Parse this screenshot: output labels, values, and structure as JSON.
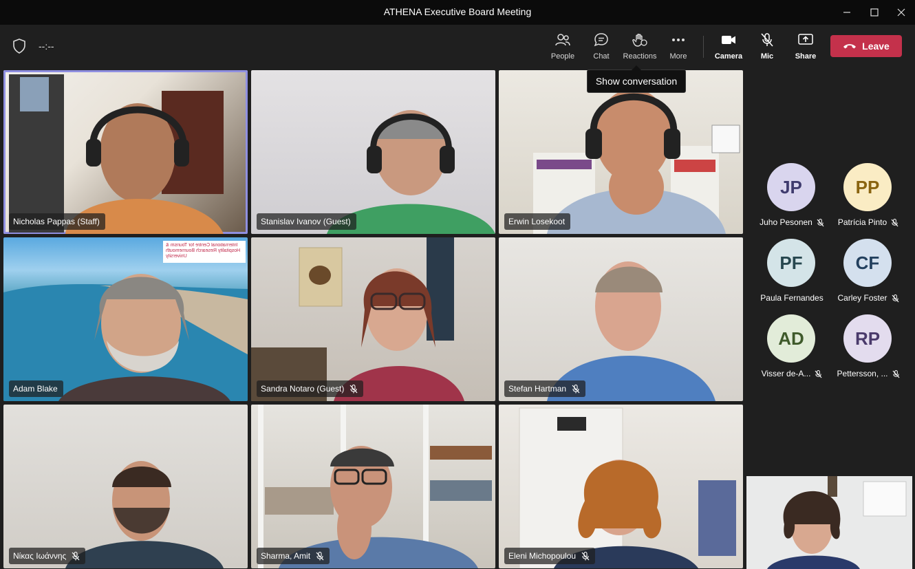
{
  "window": {
    "title": "ATHENA Executive Board Meeting"
  },
  "meeting": {
    "timer": "--:--"
  },
  "toolbar": {
    "people": "People",
    "chat": "Chat",
    "reactions": "Reactions",
    "more": "More",
    "camera": "Camera",
    "mic": "Mic",
    "share": "Share",
    "leave": "Leave"
  },
  "tooltip": "Show conversation",
  "tiles": [
    {
      "name": "Nicholas Pappas (Staff)",
      "muted": false
    },
    {
      "name": "Stanislav Ivanov (Guest)",
      "muted": false
    },
    {
      "name": "Erwin Losekoot",
      "muted": false
    },
    {
      "name": "Adam Blake",
      "muted": false
    },
    {
      "name": "Sandra Notaro (Guest)",
      "muted": true
    },
    {
      "name": "Stefan Hartman",
      "muted": true
    },
    {
      "name": "Νίκας Ιωάννης",
      "muted": true
    },
    {
      "name": "Sharma, Amit",
      "muted": true
    },
    {
      "name": "Eleni Michopoulou",
      "muted": true
    }
  ],
  "background_banner": "International Centre for Tourism & Hospitality Research Bournemouth University",
  "roster": [
    {
      "initials": "JP",
      "name": "Juho Pesonen",
      "bg": "#d9d5ee",
      "fg": "#3f3b6e"
    },
    {
      "initials": "PP",
      "name": "Patrícia Pinto",
      "bg": "#faecc4",
      "fg": "#8a6410"
    },
    {
      "initials": "PF",
      "name": "Paula Fernandes",
      "bg": "#d4e4e8",
      "fg": "#27474f"
    },
    {
      "initials": "CF",
      "name": "Carley Foster",
      "bg": "#d4e0ee",
      "fg": "#23405e"
    },
    {
      "initials": "AD",
      "name": "Visser de-A...",
      "bg": "#e2ecd9",
      "fg": "#3f5a2b"
    },
    {
      "initials": "RP",
      "name": "Pettersson, ...",
      "bg": "#e3dcee",
      "fg": "#4a3a6b"
    }
  ],
  "colors": {
    "leave": "#c4314b",
    "active_speaker": "#8f8fe0",
    "background": "#1f1f1f"
  }
}
